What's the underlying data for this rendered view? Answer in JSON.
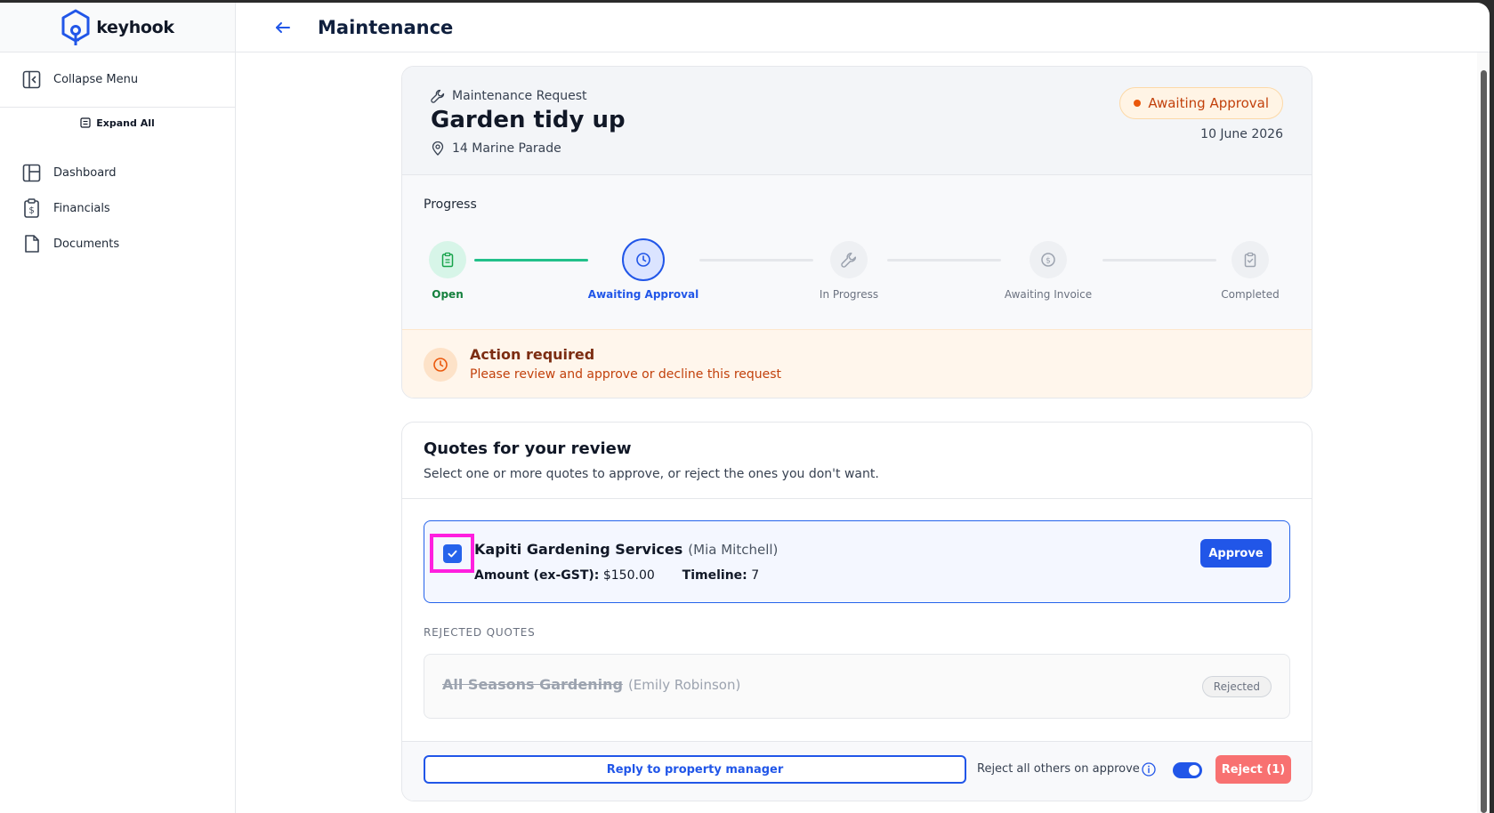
{
  "app": {
    "logo_text": "keyhook"
  },
  "sidebar": {
    "collapse_label": "Collapse Menu",
    "expand_all_label": "Expand All",
    "items": [
      {
        "label": "Dashboard",
        "icon": "dashboard-icon"
      },
      {
        "label": "Financials",
        "icon": "financials-icon"
      },
      {
        "label": "Documents",
        "icon": "document-icon"
      }
    ]
  },
  "header": {
    "title": "Maintenance"
  },
  "request": {
    "type_label": "Maintenance Request",
    "title": "Garden tidy up",
    "address": "14 Marine Parade",
    "status": "Awaiting Approval",
    "date": "10 June 2026"
  },
  "progress": {
    "label": "Progress",
    "steps": [
      {
        "label": "Open",
        "state": "done"
      },
      {
        "label": "Awaiting Approval",
        "state": "current"
      },
      {
        "label": "In Progress",
        "state": "pending"
      },
      {
        "label": "Awaiting Invoice",
        "state": "pending"
      },
      {
        "label": "Completed",
        "state": "pending"
      }
    ]
  },
  "action": {
    "title": "Action required",
    "message": "Please review and approve or decline this request"
  },
  "quotes": {
    "title": "Quotes for your review",
    "subtitle": "Select one or more quotes to approve, or reject the ones you don't want.",
    "active": {
      "company": "Kapiti Gardening Services",
      "contact": "(Mia Mitchell)",
      "amount_label": "Amount (ex-GST):",
      "amount": "$150.00",
      "timeline_label": "Timeline:",
      "timeline": "7",
      "approve_label": "Approve",
      "checked": true
    },
    "rejected_label": "REJECTED QUOTES",
    "rejected": {
      "company": "All Seasons Gardening",
      "contact": "(Emily Robinson)",
      "badge": "Rejected"
    }
  },
  "footer": {
    "reply_label": "Reply to property manager",
    "reject_others_label": "Reject all others on approve",
    "toggle_on": true,
    "reject_label": "Reject (1)"
  },
  "colors": {
    "primary": "#2156e8",
    "success": "#22c08a",
    "warning": "#ea580c",
    "danger": "#f87171",
    "highlight": "#ff1fdf"
  }
}
